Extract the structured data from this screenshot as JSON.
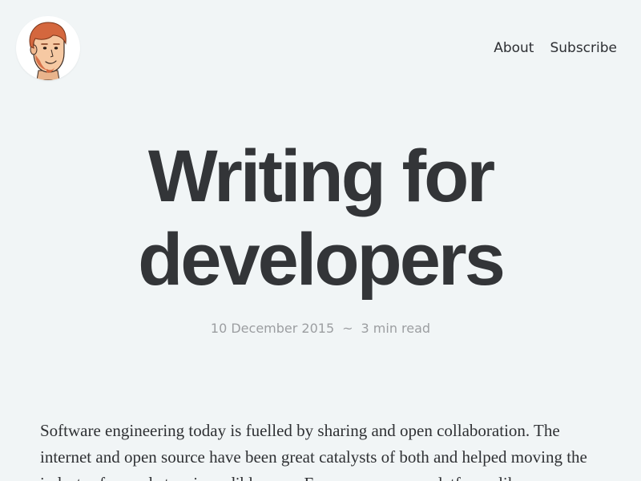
{
  "header": {
    "avatar_icon": "developer-avatar-icon",
    "nav": [
      {
        "label": "About"
      },
      {
        "label": "Subscribe"
      }
    ]
  },
  "post": {
    "title_line1": "Writing for",
    "title_line2": "developers",
    "date": "10 December 2015",
    "separator": "~",
    "read_time": "3 min read",
    "body": "Software engineering today is fuelled by sharing and open collaboration. The internet and open source have been great catalysts of both and helped moving the industry forward at an incredible pace. From open source platforms like"
  },
  "colors": {
    "background": "#f1f5f6",
    "title": "#333538",
    "meta": "#9c9ea1",
    "hair": "#d4673e"
  }
}
